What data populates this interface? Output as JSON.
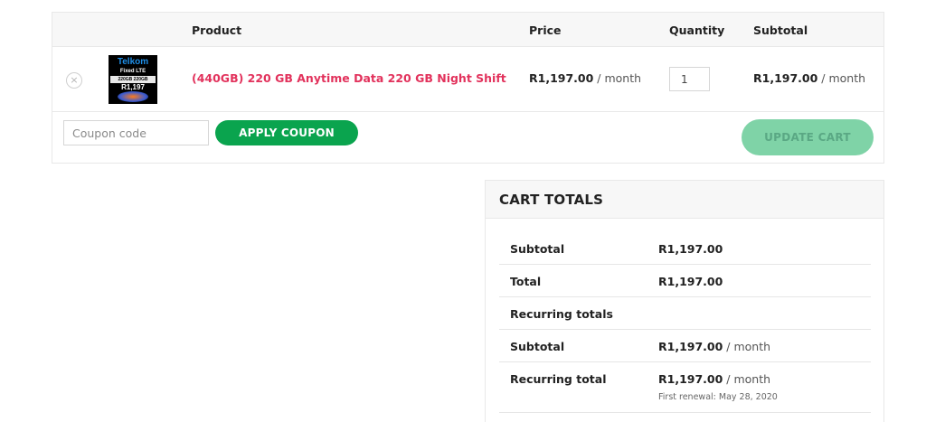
{
  "table": {
    "headers": {
      "product": "Product",
      "price": "Price",
      "quantity": "Quantity",
      "subtotal": "Subtotal"
    }
  },
  "item": {
    "remove_glyph": "×",
    "thumb": {
      "brand": "Telkom",
      "line1": "Fixed LTE",
      "line2": "220GB 220GB",
      "price": "R1,197"
    },
    "name": "(440GB) 220 GB Anytime Data 220 GB Night Shift",
    "price_amount": "R1,197.00",
    "price_period": " / month",
    "quantity": "1",
    "subtotal_amount": "R1,197.00",
    "subtotal_period": " / month"
  },
  "actions": {
    "coupon_placeholder": "Coupon code",
    "apply_label": "APPLY COUPON",
    "update_label": "UPDATE CART"
  },
  "totals": {
    "title": "CART TOTALS",
    "subtotal_label": "Subtotal",
    "subtotal_value": "R1,197.00",
    "total_label": "Total",
    "total_value": "R1,197.00",
    "recurring_heading": "Recurring totals",
    "recurring_subtotal_label": "Subtotal",
    "recurring_subtotal_amount": "R1,197.00",
    "recurring_subtotal_period": " / month",
    "recurring_total_label": "Recurring total",
    "recurring_total_amount": "R1,197.00",
    "recurring_total_period": " / month",
    "first_renewal": "First renewal: May 28, 2020"
  },
  "colors": {
    "product_link": "#e2325c",
    "apply_button": "#0aa44e",
    "update_button_disabled": "#7fd3a7"
  }
}
